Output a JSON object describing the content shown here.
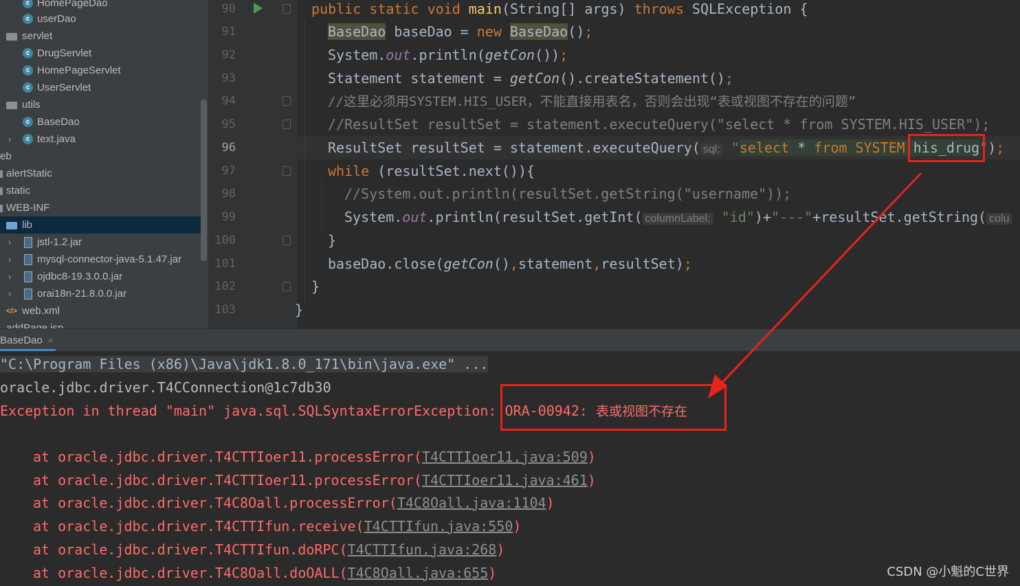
{
  "project_tree": {
    "items": [
      {
        "label": "HomePageDao",
        "type": "class",
        "indent": 2
      },
      {
        "label": "userDao",
        "type": "class",
        "indent": 2
      },
      {
        "label": "servlet",
        "type": "folder",
        "indent": 1
      },
      {
        "label": "DrugServlet",
        "type": "class",
        "indent": 2
      },
      {
        "label": "HomePageServlet",
        "type": "class",
        "indent": 2
      },
      {
        "label": "UserServlet",
        "type": "class",
        "indent": 2
      },
      {
        "label": "utils",
        "type": "folder",
        "indent": 1
      },
      {
        "label": "BaseDao",
        "type": "class",
        "indent": 2
      },
      {
        "label": "text.java",
        "type": "class",
        "indent": 2,
        "collapsed": true
      },
      {
        "label": "eb",
        "type": "text",
        "indent": 0
      },
      {
        "label": "alertStatic",
        "type": "folder-cut",
        "indent": 0
      },
      {
        "label": "static",
        "type": "folder-cut",
        "indent": 0
      },
      {
        "label": "WEB-INF",
        "type": "folder-cut",
        "indent": 0
      },
      {
        "label": "lib",
        "type": "folder",
        "indent": 1,
        "selected": true
      },
      {
        "label": "jstl-1.2.jar",
        "type": "jar",
        "indent": 2,
        "collapsed": true
      },
      {
        "label": "mysql-connector-java-5.1.47.jar",
        "type": "jar",
        "indent": 2,
        "collapsed": true
      },
      {
        "label": "ojdbc8-19.3.0.0.jar",
        "type": "jar",
        "indent": 2,
        "collapsed": true
      },
      {
        "label": "orai18n-21.8.0.0.jar",
        "type": "jar",
        "indent": 2,
        "collapsed": true
      },
      {
        "label": "web.xml",
        "type": "xml",
        "indent": 1
      },
      {
        "label": "addPage.jsp",
        "type": "text",
        "indent": 0
      }
    ]
  },
  "editor": {
    "line_numbers": [
      "90",
      "91",
      "92",
      "93",
      "94",
      "95",
      "96",
      "97",
      "98",
      "99",
      "100",
      "101",
      "102",
      "103"
    ],
    "current_line": "96",
    "lines": {
      "l90": {
        "kw1": "public static void ",
        "fn": "main",
        "p1": "(String[] args) ",
        "kw2": "throws",
        "p2": " SQLException {"
      },
      "l91": {
        "t1": "BaseDao",
        "t2": " baseDao = ",
        "kw": "new",
        "t3": " ",
        "t4": "BaseDao",
        "t5": "()",
        "semi": ";"
      },
      "l92": {
        "t1": "System.",
        "sf": "out",
        "t2": ".println(",
        "it": "getCon",
        "t3": "())",
        "semi": ";"
      },
      "l93": {
        "t1": "Statement statement = ",
        "it": "getCon",
        "t2": "().createStatement()",
        "semi": ";"
      },
      "l94": {
        "cm": "//这里必须用SYSTEM.HIS_USER，不能直接用表名，否则会出现“表或视图不存在的问题”"
      },
      "l95": {
        "cm": "//ResultSet resultSet = statement.executeQuery(\"select * from SYSTEM.HIS_USER\");"
      },
      "l96": {
        "t1": "ResultSet resultSet = statement.executeQuery(",
        "hint": "sql:",
        "st1": "\"",
        "st2": "select ",
        "op": "*",
        "st3": " from ",
        "st4": "SYSTEM.",
        "st5": "his_drug",
        "st6": "\"",
        "t2": ")",
        "semi": ";"
      },
      "l97": {
        "kw": "while",
        "t1": " (resultSet.next()){"
      },
      "l98": {
        "cm": "//System.out.println(resultSet.getString(\"username\"));"
      },
      "l99": {
        "t1": "System.",
        "sf": "out",
        "t2": ".println(resultSet.getInt(",
        "hint": "columnLabel:",
        "st1": "\"id\"",
        "t3": ")+",
        "st2": "\"---\"",
        "t4": "+resultSet.getString(",
        "hint2": "colu"
      },
      "l100": {
        "t1": "}"
      },
      "l101": {
        "t1": "baseDao.close(",
        "it": "getCon",
        "t2": "()",
        "c1": ",",
        "t3": "statement",
        "c2": ",",
        "t4": "resultSet)",
        "semi": ";"
      },
      "l102": {
        "t1": "}"
      },
      "l103": {
        "t1": "}"
      }
    }
  },
  "console": {
    "tab_label": "BaseDao",
    "tab_close": "×",
    "cmd": "\"C:\\Program Files (x86)\\Java\\jdk1.8.0_171\\bin\\java.exe\" ...",
    "output_line": "oracle.jdbc.driver.T4CConnection@1c7db30",
    "exception_prefix": "Exception in thread \"main\" java.sql.SQLSyntaxErrorException: ",
    "exception_code": "ORA-00942: ",
    "exception_msg": "表或视图不存在",
    "stack": [
      {
        "prefix": "\tat oracle.jdbc.driver.T4CTTIoer11.processError(",
        "link": "T4CTTIoer11.java:509",
        "suffix": ")"
      },
      {
        "prefix": "\tat oracle.jdbc.driver.T4CTTIoer11.processError(",
        "link": "T4CTTIoer11.java:461",
        "suffix": ")"
      },
      {
        "prefix": "\tat oracle.jdbc.driver.T4C8Oall.processError(",
        "link": "T4C8Oall.java:1104",
        "suffix": ")"
      },
      {
        "prefix": "\tat oracle.jdbc.driver.T4CTTIfun.receive(",
        "link": "T4CTTIfun.java:550",
        "suffix": ")"
      },
      {
        "prefix": "\tat oracle.jdbc.driver.T4CTTIfun.doRPC(",
        "link": "T4CTTIfun.java:268",
        "suffix": ")"
      },
      {
        "prefix": "\tat oracle.jdbc.driver.T4C8Oall.doOALL(",
        "link": "T4C8Oall.java:655",
        "suffix": ")"
      }
    ]
  },
  "watermark": "CSDN @小魁的C世界",
  "colors": {
    "annotation": "#e8231c",
    "error": "#ff6b68",
    "keyword": "#cc7832",
    "string": "#6a8759"
  }
}
